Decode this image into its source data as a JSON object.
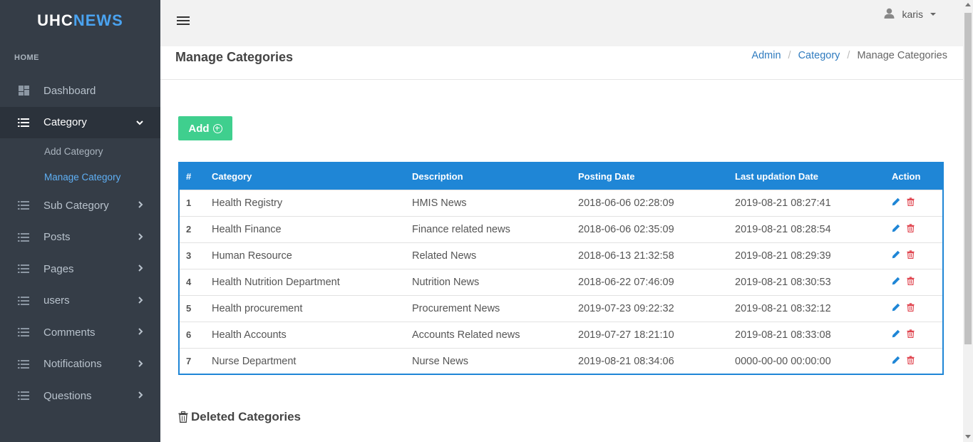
{
  "brand": {
    "part1": "UHC",
    "part2": "NEWS"
  },
  "sidebar": {
    "section_label": "HOME",
    "items": [
      {
        "label": "Dashboard",
        "icon": "dashboard-icon"
      },
      {
        "label": "Category",
        "icon": "list-icon",
        "active": true
      },
      {
        "label": "Sub Category",
        "icon": "list-icon"
      },
      {
        "label": "Posts",
        "icon": "list-icon"
      },
      {
        "label": "Pages",
        "icon": "list-icon"
      },
      {
        "label": "users",
        "icon": "list-icon"
      },
      {
        "label": "Comments",
        "icon": "list-icon"
      },
      {
        "label": "Notifications",
        "icon": "list-icon"
      },
      {
        "label": "Questions",
        "icon": "list-icon"
      }
    ],
    "category_submenu": [
      {
        "label": "Add Category"
      },
      {
        "label": "Manage Category",
        "current": true
      }
    ]
  },
  "topbar": {
    "username": "karis"
  },
  "page": {
    "title": "Manage Categories",
    "breadcrumb": [
      "Admin",
      "Category",
      "Manage Categories"
    ],
    "add_label": "Add",
    "deleted_title": "Deleted Categories"
  },
  "table": {
    "headers": [
      "#",
      "Category",
      "Description",
      "Posting Date",
      "Last updation Date",
      "Action"
    ],
    "rows": [
      [
        "1",
        "Health Registry",
        "HMIS News",
        "2018-06-06 02:28:09",
        "2019-08-21 08:27:41"
      ],
      [
        "2",
        "Health Finance",
        "Finance related news",
        "2018-06-06 02:35:09",
        "2019-08-21 08:28:54"
      ],
      [
        "3",
        "Human Resource",
        "Related News",
        "2018-06-13 21:32:58",
        "2019-08-21 08:29:39"
      ],
      [
        "4",
        "Health Nutrition Department",
        "Nutrition News",
        "2018-06-22 07:46:09",
        "2019-08-21 08:30:53"
      ],
      [
        "5",
        "Health procurement",
        "Procurement News",
        "2019-07-23 09:22:32",
        "2019-08-21 08:32:12"
      ],
      [
        "6",
        "Health Accounts",
        "Accounts Related news",
        "2019-07-27 18:21:10",
        "2019-08-21 08:33:08"
      ],
      [
        "7",
        "Nurse Department",
        "Nurse News",
        "2019-08-21 08:34:06",
        "0000-00-00 00:00:00"
      ]
    ]
  },
  "colors": {
    "sidebar_bg": "#353d47",
    "brand_accent": "#4aa3f0",
    "table_header": "#1f86d6",
    "add_button": "#3fcf8e",
    "edit_icon": "#1f86d6",
    "delete_icon": "#e0454f"
  }
}
